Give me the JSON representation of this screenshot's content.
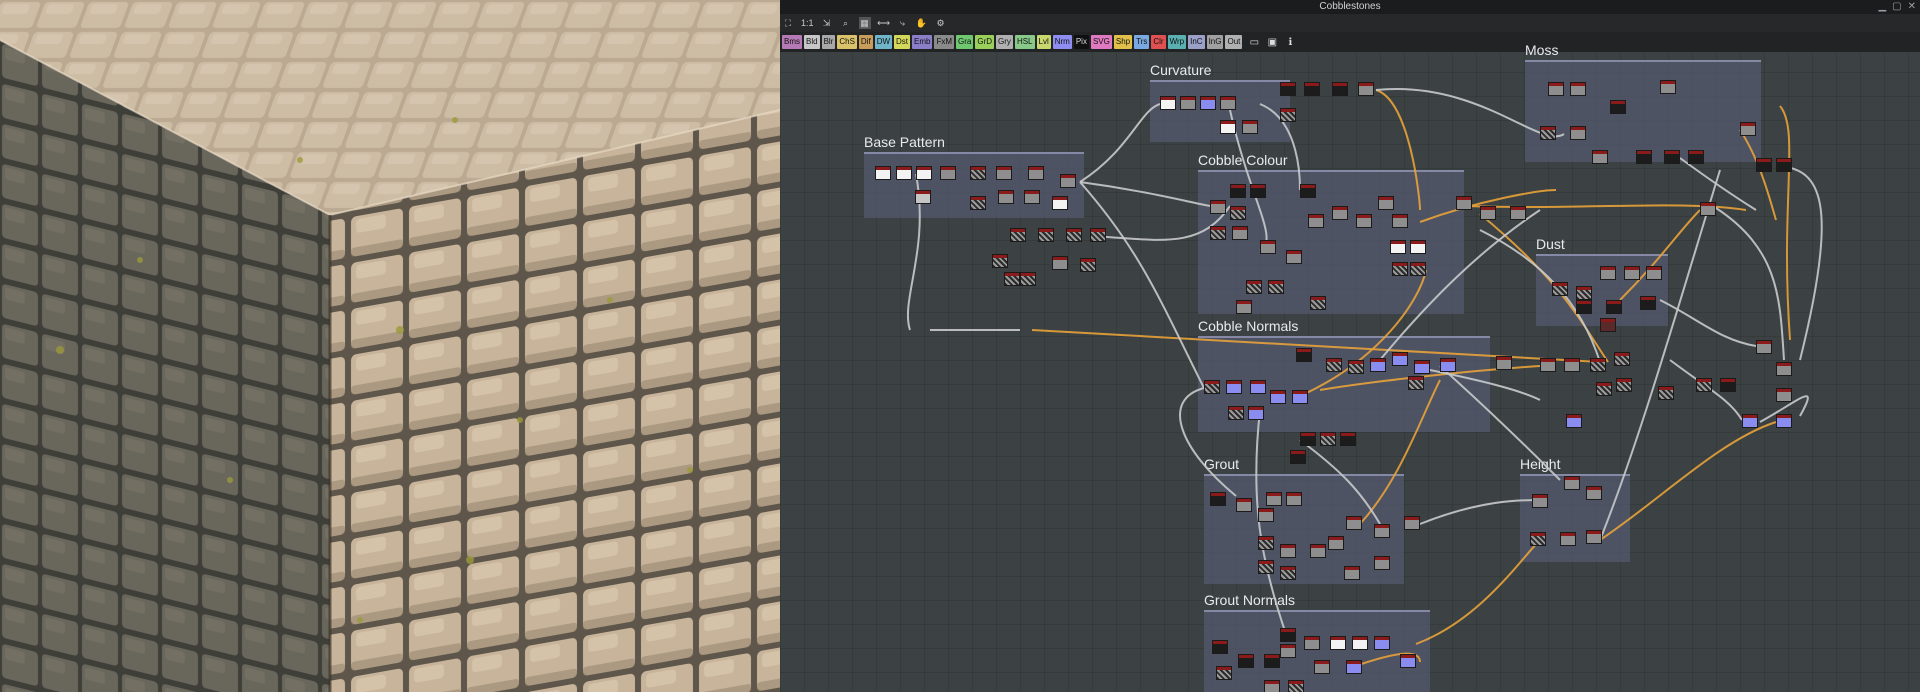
{
  "window": {
    "title": "Cobblestones"
  },
  "toolbar": {
    "zoom_label": "1:1",
    "buttons": [
      "fit-icon",
      "align-icon",
      "search-icon",
      "link-icon",
      "hand-icon",
      "gear-icon"
    ]
  },
  "node_palette": [
    {
      "label": "Bms",
      "color": "#b57ab5"
    },
    {
      "label": "Bld",
      "color": "#c7c7c7"
    },
    {
      "label": "Blr",
      "color": "#a8a8a8"
    },
    {
      "label": "ChS",
      "color": "#d9c26a"
    },
    {
      "label": "Dif",
      "color": "#c89d5a"
    },
    {
      "label": "DW",
      "color": "#6fb4c8"
    },
    {
      "label": "Dst",
      "color": "#d4d85a"
    },
    {
      "label": "Emb",
      "color": "#8b7ec8"
    },
    {
      "label": "FxM",
      "color": "#8a8a8a"
    },
    {
      "label": "Gra",
      "color": "#6fc86f"
    },
    {
      "label": "GrD",
      "color": "#9ad05a"
    },
    {
      "label": "Gry",
      "color": "#b0b0b0"
    },
    {
      "label": "HSL",
      "color": "#88c888"
    },
    {
      "label": "Lvl",
      "color": "#c8d86f"
    },
    {
      "label": "Nrm",
      "color": "#8e8ef2"
    },
    {
      "label": "Pix",
      "color": "#101010"
    },
    {
      "label": "SVG",
      "color": "#e07ac0"
    },
    {
      "label": "Shp",
      "color": "#e0c04a"
    },
    {
      "label": "Trs",
      "color": "#7aa8e0"
    },
    {
      "label": "Clr",
      "color": "#e05050"
    },
    {
      "label": "Wrp",
      "color": "#5ab0b0"
    },
    {
      "label": "InC",
      "color": "#9aa0c8"
    },
    {
      "label": "InG",
      "color": "#a0a0a0"
    },
    {
      "label": "Out",
      "color": "#b0b0b0"
    }
  ],
  "frames": [
    {
      "id": "base",
      "title": "Base Pattern"
    },
    {
      "id": "curv",
      "title": "Curvature"
    },
    {
      "id": "ccol",
      "title": "Cobble Colour"
    },
    {
      "id": "moss",
      "title": "Moss"
    },
    {
      "id": "dust",
      "title": "Dust"
    },
    {
      "id": "cnrm",
      "title": "Cobble Normals"
    },
    {
      "id": "grout",
      "title": "Grout"
    },
    {
      "id": "height",
      "title": "Height"
    },
    {
      "id": "gnrm",
      "title": "Grout Normals"
    }
  ],
  "colors": {
    "wire_grey": "#c8cacb",
    "wire_orange": "#e8a23a",
    "node_header_red": "#8b1a1a",
    "normal_node": "#8a8cf0",
    "frame_bg": "#565a70"
  }
}
